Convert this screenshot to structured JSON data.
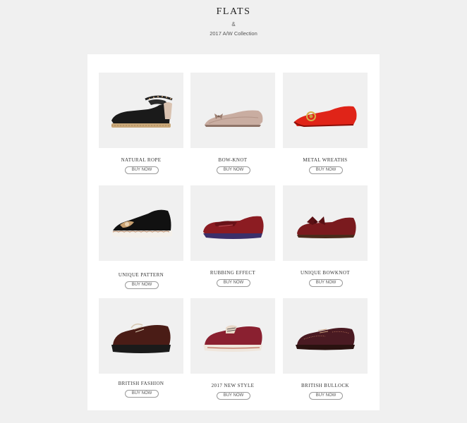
{
  "header": {
    "title": "FLATS",
    "ampersand": "&",
    "collection": "2017 A/W Collection"
  },
  "products": [
    {
      "name": "NATURAL ROPE",
      "button": "BUY NOW"
    },
    {
      "name": "BOW-KNOT",
      "button": "BUY NOW"
    },
    {
      "name": "METAL WREATHS",
      "button": "BUY NOW"
    },
    {
      "name": "UNIQUE PATTERN",
      "button": "BUY NOW"
    },
    {
      "name": "RUBBING EFFECT",
      "button": "BUY NOW"
    },
    {
      "name": "UNIQUE BOWKNOT",
      "button": "BUY NOW"
    },
    {
      "name": "BRITISH FASHION",
      "button": "BUY NOW"
    },
    {
      "name": "2017 NEW STYLE",
      "button": "BUY NOW"
    },
    {
      "name": "BRITISH BULLOCK",
      "button": "BUY NOW"
    }
  ]
}
